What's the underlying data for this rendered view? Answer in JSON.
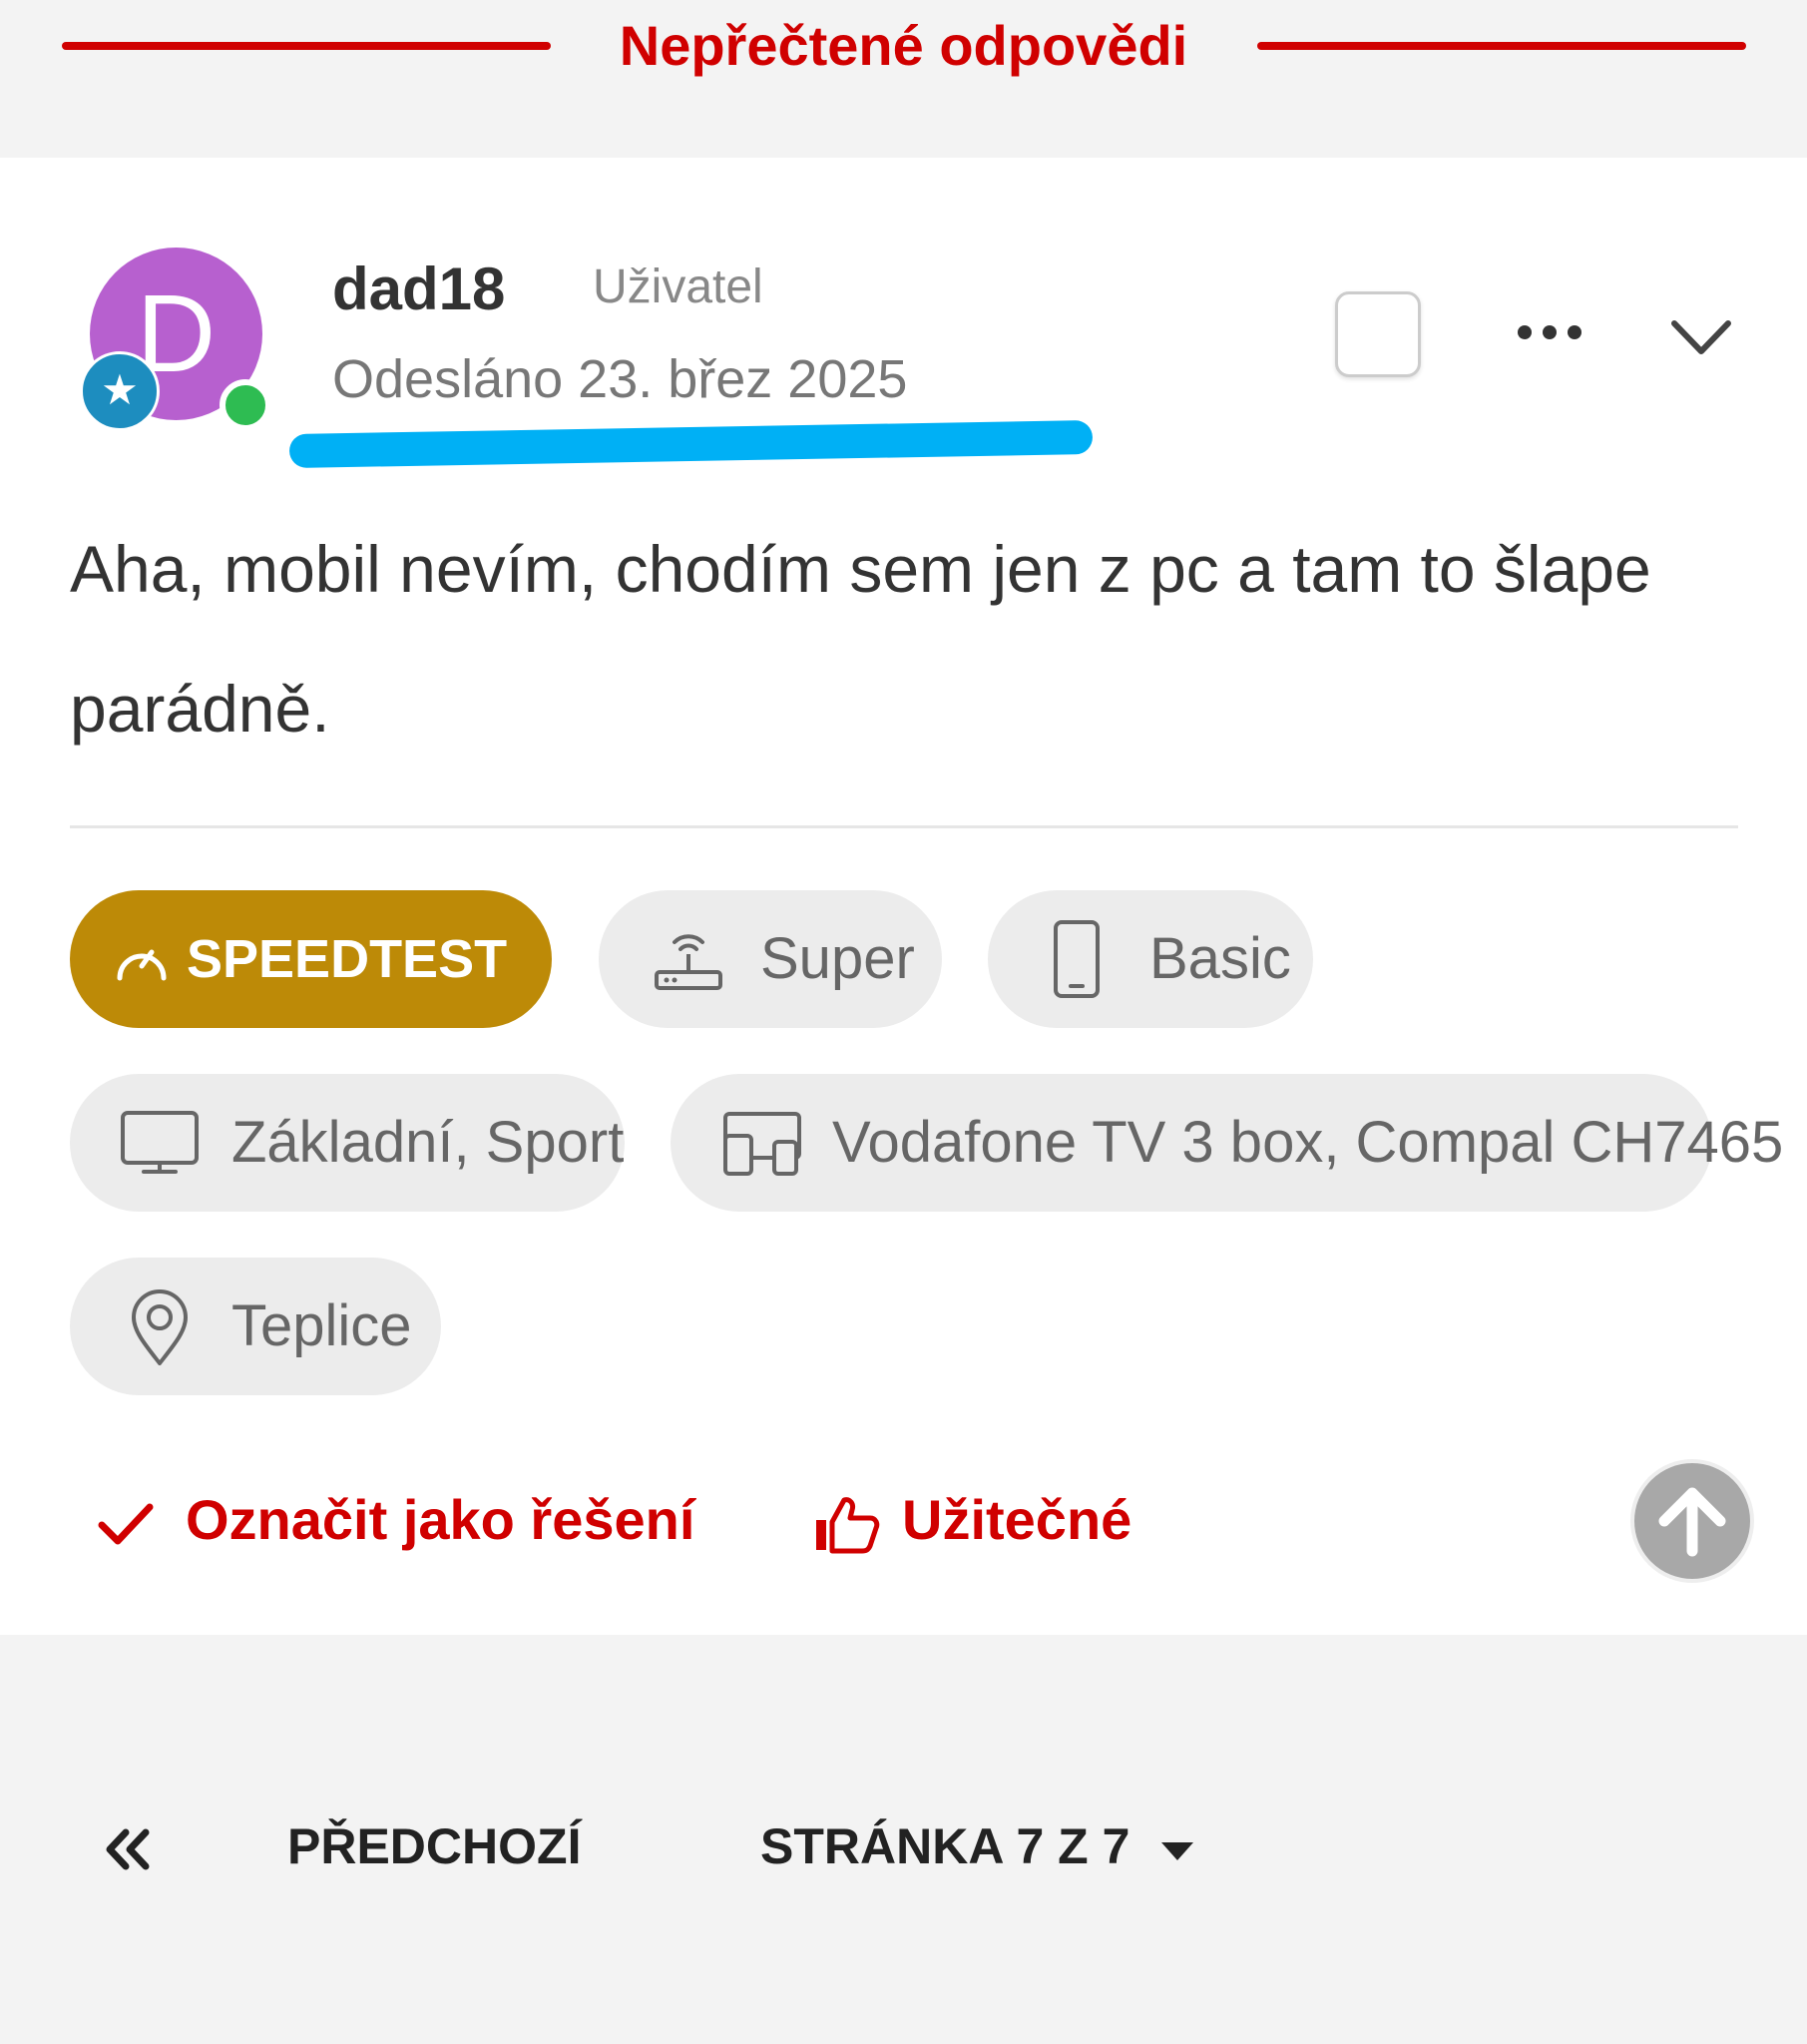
{
  "header": {
    "title": "Nepřečtené odpovědi"
  },
  "post": {
    "avatar_letter": "D",
    "username": "dad18",
    "role": "Uživatel",
    "posted": "Odesláno 23. břez 2025",
    "body": "Aha, mobil nevím, chodím sem jen z pc a tam to šlape parádně."
  },
  "tags": {
    "speedtest": "SPEEDTEST",
    "internet": "Super",
    "mobile": "Basic",
    "tv": "Základní, Sport",
    "devices": "Vodafone TV 3 box, Compal CH7465",
    "location": "Teplice"
  },
  "actions": {
    "solution": "Označit jako řešení",
    "helpful": "Užitečné"
  },
  "pagination": {
    "previous": "PŘEDCHOZÍ",
    "page": "STRÁNKA 7 Z 7"
  },
  "colors": {
    "brand_red": "#d00000",
    "speedtest_gold": "#bd8a07",
    "avatar_purple": "#b760cf",
    "online_green": "#2ebc52",
    "highlight_blue": "#00b0f5"
  },
  "icons": [
    "star-badge-icon",
    "more-icon",
    "chevron-down-icon",
    "speedometer-icon",
    "router-icon",
    "phone-icon",
    "tv-icon",
    "devices-icon",
    "location-pin-icon",
    "check-icon",
    "thumbs-up-icon",
    "arrow-up-icon",
    "double-chevron-left-icon",
    "caret-down-icon"
  ]
}
